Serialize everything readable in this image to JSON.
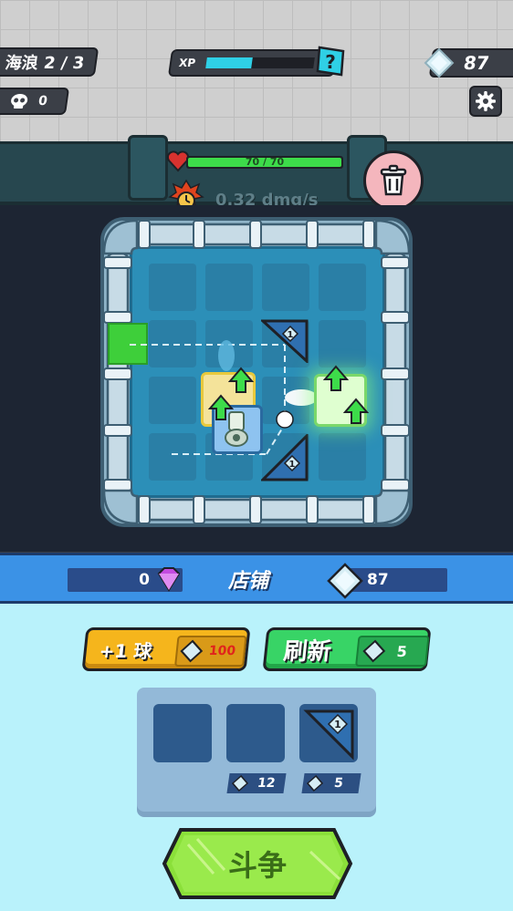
{
  "hud": {
    "wave_label": "海浪 2 / 3",
    "kills": "0",
    "xp_label": "XP",
    "xp_progress": 0.42,
    "gems": "87",
    "hp_label": "70 / 70",
    "hp_progress": 1.0,
    "dps_label": "0.32 dmg/s"
  },
  "board": {
    "ramp_tier": "1"
  },
  "shop": {
    "title": "店铺",
    "crystals": "0",
    "gems": "87",
    "plus_ball_label": "+1 球",
    "plus_ball_price": "100",
    "refresh_label": "刷新",
    "refresh_price": "5",
    "slots": [
      {
        "item": "",
        "price": ""
      },
      {
        "item": "",
        "price": "12"
      },
      {
        "item": "ramp",
        "tier": "1",
        "price": "5"
      }
    ]
  },
  "fight_label": "斗争",
  "colors": {
    "xp_fill": "#2fd0e6",
    "hp_fill": "#3ddc4a",
    "gate": "#3ecf3a",
    "shop_bar": "#3b92e6",
    "fight_button": "#8be03a",
    "plus_ball_button": "#f5b51c",
    "refresh_button": "#38d466"
  }
}
